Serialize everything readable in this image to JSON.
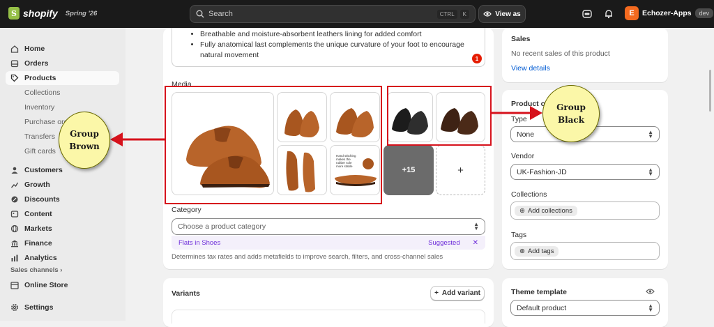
{
  "topbar": {
    "brand": "shopify",
    "edition": "Spring '26",
    "search_placeholder": "Search",
    "shortcut_1": "CTRL",
    "shortcut_2": "K",
    "view_as": "View as",
    "store_initial": "E",
    "store_name": "Echozer-Apps",
    "store_badge": "dev"
  },
  "sidebar": {
    "items": [
      {
        "label": "Home",
        "icon": "home-icon"
      },
      {
        "label": "Orders",
        "icon": "inbox-icon"
      },
      {
        "label": "Products",
        "icon": "tag-icon",
        "active": true
      },
      {
        "label": "Collections"
      },
      {
        "label": "Inventory"
      },
      {
        "label": "Purchase orders"
      },
      {
        "label": "Transfers"
      },
      {
        "label": "Gift cards"
      },
      {
        "label": "Customers",
        "icon": "person-icon"
      },
      {
        "label": "Growth",
        "icon": "growth-icon"
      },
      {
        "label": "Discounts",
        "icon": "discount-icon"
      },
      {
        "label": "Content",
        "icon": "content-icon"
      },
      {
        "label": "Markets",
        "icon": "globe-icon"
      },
      {
        "label": "Finance",
        "icon": "bank-icon"
      },
      {
        "label": "Analytics",
        "icon": "chart-icon"
      }
    ],
    "sales_channels": "Sales channels",
    "online_store": "Online Store",
    "settings": "Settings"
  },
  "description": {
    "bullets": [
      "Breathable and moisture-absorbent leathers lining for added comfort",
      "Fully anatomical last complements the unique curvature of your foot to encourage natural movement"
    ],
    "issue_count": "1"
  },
  "media": {
    "label": "Media",
    "more_count": "+15",
    "add": "+",
    "tile5_text": "Hand stitching makes the rubber sole more stable"
  },
  "category": {
    "label": "Category",
    "placeholder": "Choose a product category",
    "suggestion": "Flats in Shoes",
    "suggested": "Suggested",
    "help": "Determines tax rates and adds metafields to improve search, filters, and cross-channel sales"
  },
  "variants": {
    "title": "Variants",
    "add_variant": "Add variant"
  },
  "sales": {
    "title": "Sales",
    "empty": "No recent sales of this product",
    "link": "View details"
  },
  "organization": {
    "title": "Product organization",
    "type_label": "Type",
    "type_value": "None",
    "vendor_label": "Vendor",
    "vendor_value": "UK-Fashion-JD",
    "collections_label": "Collections",
    "collections_add": "Add collections",
    "tags_label": "Tags",
    "tags_add": "Add tags"
  },
  "theme": {
    "title": "Theme template",
    "value": "Default product"
  },
  "annotations": {
    "brown": "Group\nBrown",
    "black": "Group\nBlack"
  },
  "colors": {
    "annotation_red": "#d6121c",
    "bubble_fill": "#fbf7a8",
    "suggestion_purple": "#6c2bd9",
    "brown_leather": "#a8561f",
    "black_leather": "#1c1c1c"
  }
}
